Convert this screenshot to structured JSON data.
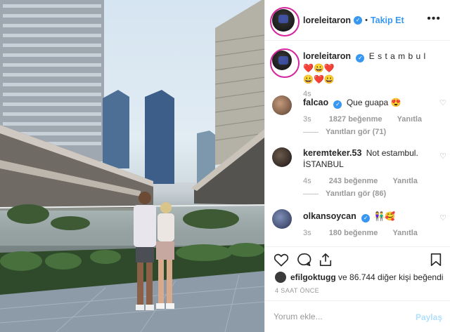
{
  "post": {
    "author": "loreleitaron",
    "follow_label": "Takip Et",
    "separator": "•",
    "more_label": "•••"
  },
  "caption": {
    "author": "loreleitaron",
    "text": "E s t a m b u l",
    "emojis_line1": "❤️😀❤️",
    "emojis_line2": "😀❤️😀",
    "time": "4s"
  },
  "comments": [
    {
      "author": "falcao",
      "verified": true,
      "text": "Que guapa 😍",
      "time": "3s",
      "likes": "1827 beğenme",
      "reply_label": "Yanıtla",
      "view_replies": "Yanıtları gör (71)"
    },
    {
      "author": "keremteker.53",
      "verified": false,
      "text": "Not estambul. İSTANBUL",
      "time": "4s",
      "likes": "243 beğenme",
      "reply_label": "Yanıtla",
      "view_replies": "Yanıtları gör (86)"
    },
    {
      "author": "olkansoycan",
      "verified": true,
      "text": "👫🥰",
      "time": "3s",
      "likes": "180 beğenme",
      "reply_label": "Yanıtla"
    }
  ],
  "likes_line": {
    "user": "efilgoktugg",
    "rest": " ve 86.744 diğer kişi beğendi"
  },
  "timestamp": "4 SAAT ÖNCE",
  "comment_box": {
    "placeholder": "Yorum ekle...",
    "submit_label": "Paylaş"
  },
  "colors": {
    "accent": "#3897f0",
    "story_ring": "#d6249f",
    "muted": "#999999"
  },
  "icons": [
    "heart-icon",
    "comment-icon",
    "share-icon",
    "bookmark-icon",
    "more-options-icon",
    "verified-badge-icon"
  ]
}
